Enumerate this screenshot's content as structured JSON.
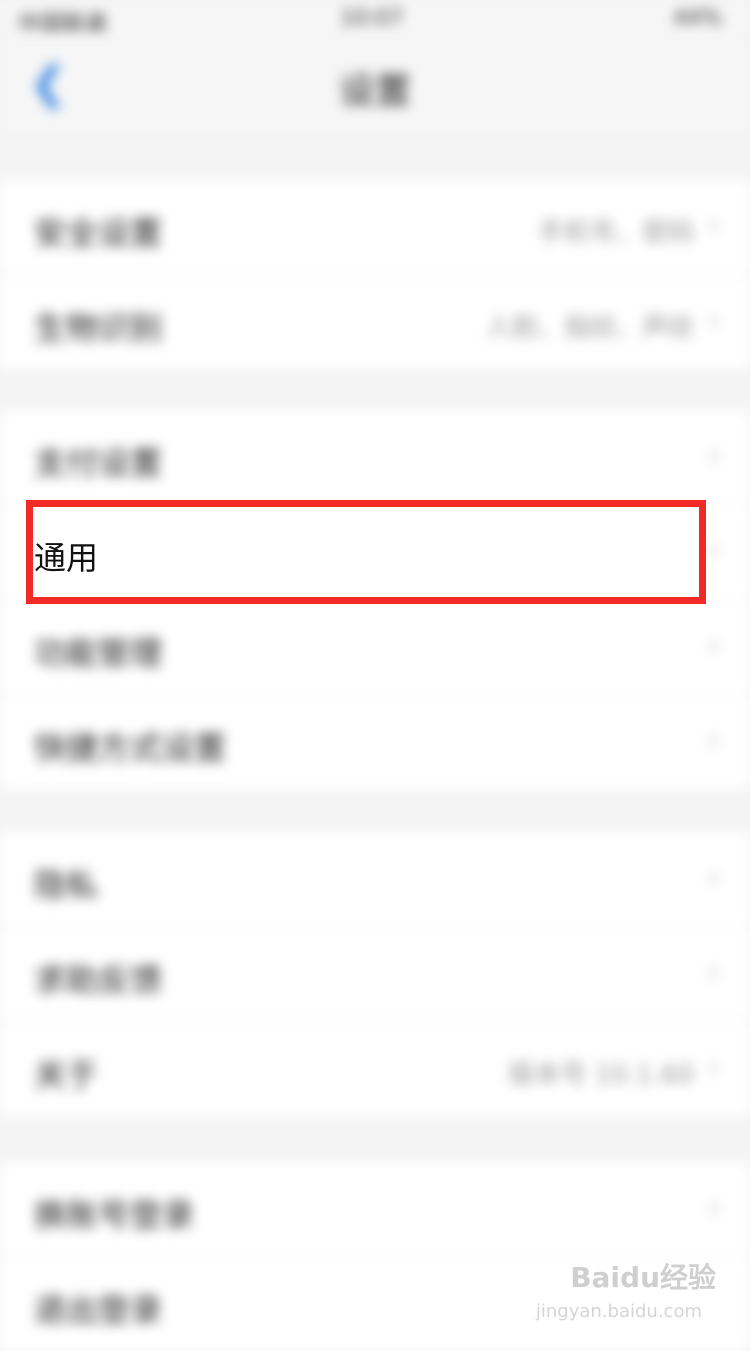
{
  "status_bar": {
    "carrier": "中国联通",
    "time": "10:07",
    "battery": "44%"
  },
  "nav": {
    "back_icon": "chevron-left-icon",
    "title": "设置"
  },
  "groups": [
    {
      "rows": [
        {
          "label": "安全设置",
          "value": "手机号、密码"
        },
        {
          "label": "生物识别",
          "value": "人脸、指纹、声纹"
        }
      ]
    },
    {
      "rows": [
        {
          "label": "支付设置",
          "value": ""
        },
        {
          "label": "通用",
          "value": ""
        },
        {
          "label": "功能管理",
          "value": ""
        },
        {
          "label": "快捷方式设置",
          "value": ""
        }
      ]
    },
    {
      "rows": [
        {
          "label": "隐私",
          "value": ""
        },
        {
          "label": "求助反馈",
          "value": ""
        },
        {
          "label": "关于",
          "value": "版本号 10.1.60"
        }
      ]
    },
    {
      "rows": [
        {
          "label": "换账号登录",
          "value": ""
        },
        {
          "label": "退出登录",
          "value": ""
        }
      ]
    }
  ],
  "highlighted_label": "通用",
  "colors": {
    "highlight": "#f22a26",
    "back": "#2a7de1"
  },
  "watermark": {
    "brand": "Baidu经验",
    "url": "jingyan.baidu.com"
  }
}
